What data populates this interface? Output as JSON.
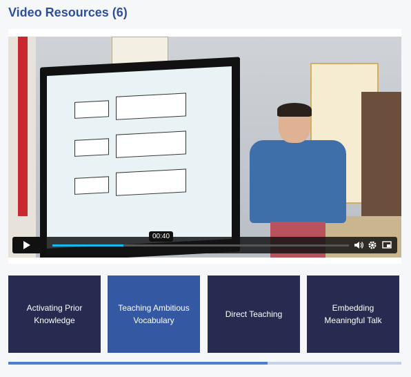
{
  "header": {
    "title": "Video Resources (6)"
  },
  "player": {
    "timestamp": "00:40",
    "progress": 0.24,
    "play_icon": "play-icon",
    "volume_icon": "volume-icon",
    "settings_icon": "gear-icon",
    "pip_icon": "picture-in-picture-icon"
  },
  "tiles": [
    {
      "label": "Activating Prior Knowledge",
      "active": false
    },
    {
      "label": "Teaching Ambitious Vocabulary",
      "active": true
    },
    {
      "label": "Direct Teaching",
      "active": false
    },
    {
      "label": "Embedding Meaningful Talk",
      "active": false
    }
  ],
  "carousel": {
    "scroll_fraction": 0.66
  },
  "colors": {
    "title": "#2e4f9b",
    "tile": "#262b4f",
    "tile_active": "#3558a3",
    "progress": "#1ab7ea"
  }
}
